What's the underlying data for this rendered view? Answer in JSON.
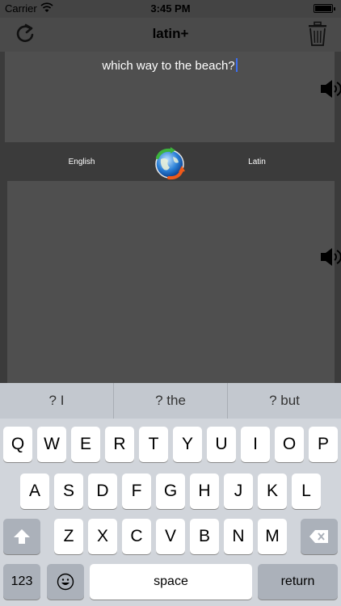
{
  "status_bar": {
    "carrier": "Carrier",
    "time": "3:45 PM"
  },
  "nav": {
    "title": "latin+",
    "refresh_icon": "refresh-icon",
    "trash_icon": "trash-icon"
  },
  "source": {
    "text": "which way to the beach?"
  },
  "languages": {
    "from": "English",
    "to": "Latin"
  },
  "keyboard": {
    "suggestions": [
      "? I",
      "? the",
      "? but"
    ],
    "row1": [
      "Q",
      "W",
      "E",
      "R",
      "T",
      "Y",
      "U",
      "I",
      "O",
      "P"
    ],
    "row2": [
      "A",
      "S",
      "D",
      "F",
      "G",
      "H",
      "J",
      "K",
      "L"
    ],
    "row3": [
      "Z",
      "X",
      "C",
      "V",
      "B",
      "N",
      "M"
    ],
    "numbers_label": "123",
    "space_label": "space",
    "return_label": "return"
  },
  "colors": {
    "caret": "#3b6ef0",
    "panel": "#4f4f4f",
    "background": "#3b3b3b"
  }
}
